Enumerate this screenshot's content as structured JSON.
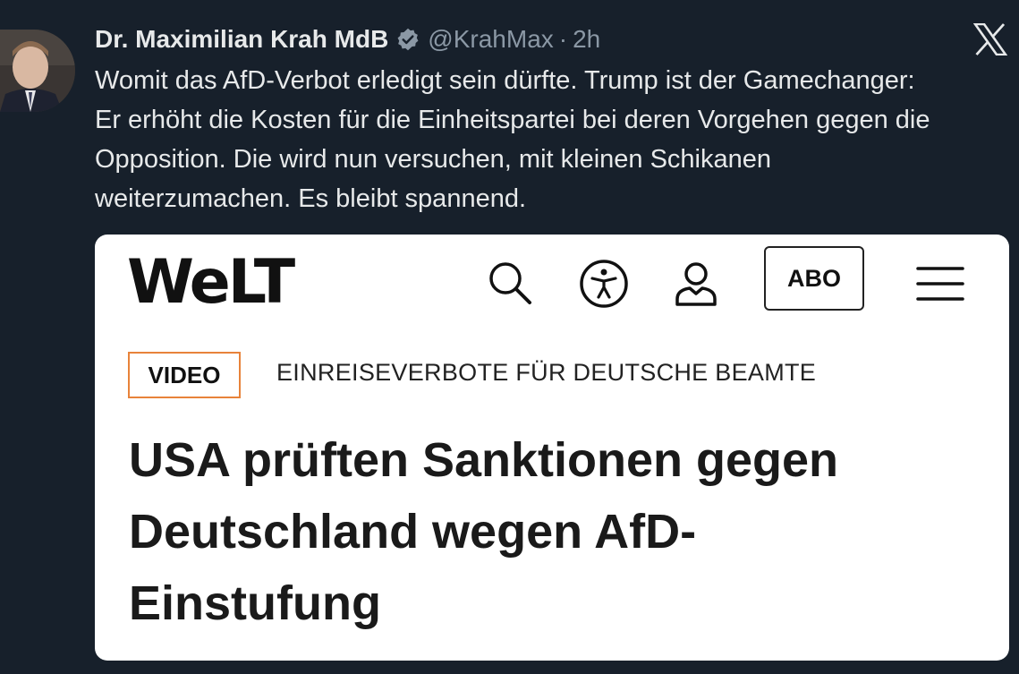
{
  "tweet": {
    "display_name": "Dr. Maximilian Krah MdB",
    "handle": "@KrahMax",
    "separator": "·",
    "time": "2h",
    "text_lines": [
      "Womit das AfD-Verbot erledigt sein dürfte. Trump ist der Gamechanger:",
      "Er erhöht die Kosten für die Einheitspartei bei deren Vorgehen gegen die",
      "Opposition. Die wird nun versuchen, mit kleinen Schikanen",
      "weiterzumachen. Es bleibt spannend."
    ]
  },
  "card": {
    "logo": "WeLT",
    "abo_label": "ABO",
    "badge": "VIDEO",
    "kicker": "EINREISEVERBOTE FÜR DEUTSCHE BEAMTE",
    "headline_lines": [
      "USA prüften Sanktionen gegen",
      "Deutschland wegen AfD-",
      "Einstufung"
    ]
  },
  "icons": [
    "verified-icon",
    "x-logo-icon",
    "search-icon",
    "accessibility-icon",
    "user-icon",
    "menu-icon"
  ],
  "colors": {
    "background": "#17202b",
    "text": "#e7e9ea",
    "muted": "#8b98a5",
    "badge_border": "#e8833a"
  }
}
